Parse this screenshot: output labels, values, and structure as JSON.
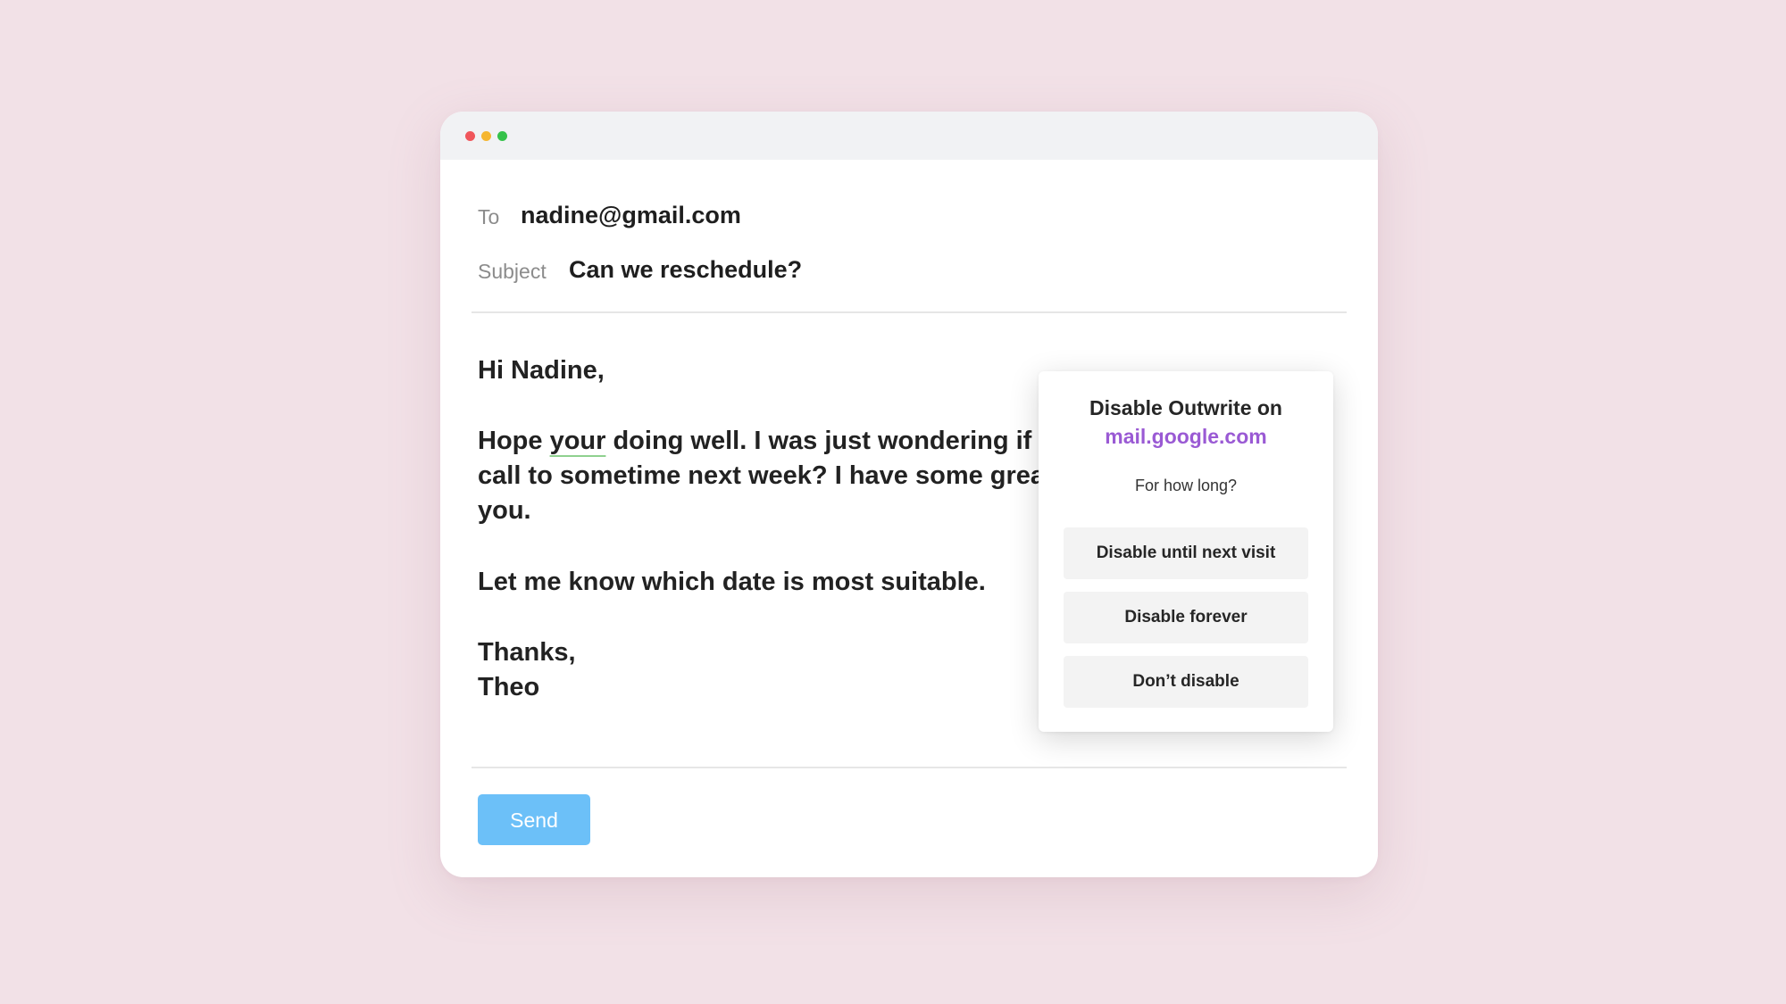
{
  "email": {
    "to_label": "To",
    "to_value": "nadine@gmail.com",
    "subject_label": "Subject",
    "subject_value": "Can we reschedule?",
    "body": {
      "greeting": "Hi Nadine,",
      "p1_line1_a": "Hope ",
      "p1_line1_underlined": "your",
      "p1_line1_b": " doing well. I was just wondering if w",
      "p1_line2": "call to sometime next week? I have some grea",
      "p1_line3": "you.",
      "p2": "Let me know which date is most suitable.",
      "signoff": "Thanks,",
      "name": "Theo"
    },
    "send_label": "Send"
  },
  "popup": {
    "title": "Disable Outwrite on",
    "domain": "mail.google.com",
    "question": "For how long?",
    "options": [
      "Disable until next visit",
      "Disable forever",
      "Don’t disable"
    ]
  },
  "colors": {
    "background": "#f2e1e7",
    "send_button": "#6cc0f8",
    "domain_accent": "#9a5ad4",
    "grammar_underline": "#8fd18f"
  }
}
